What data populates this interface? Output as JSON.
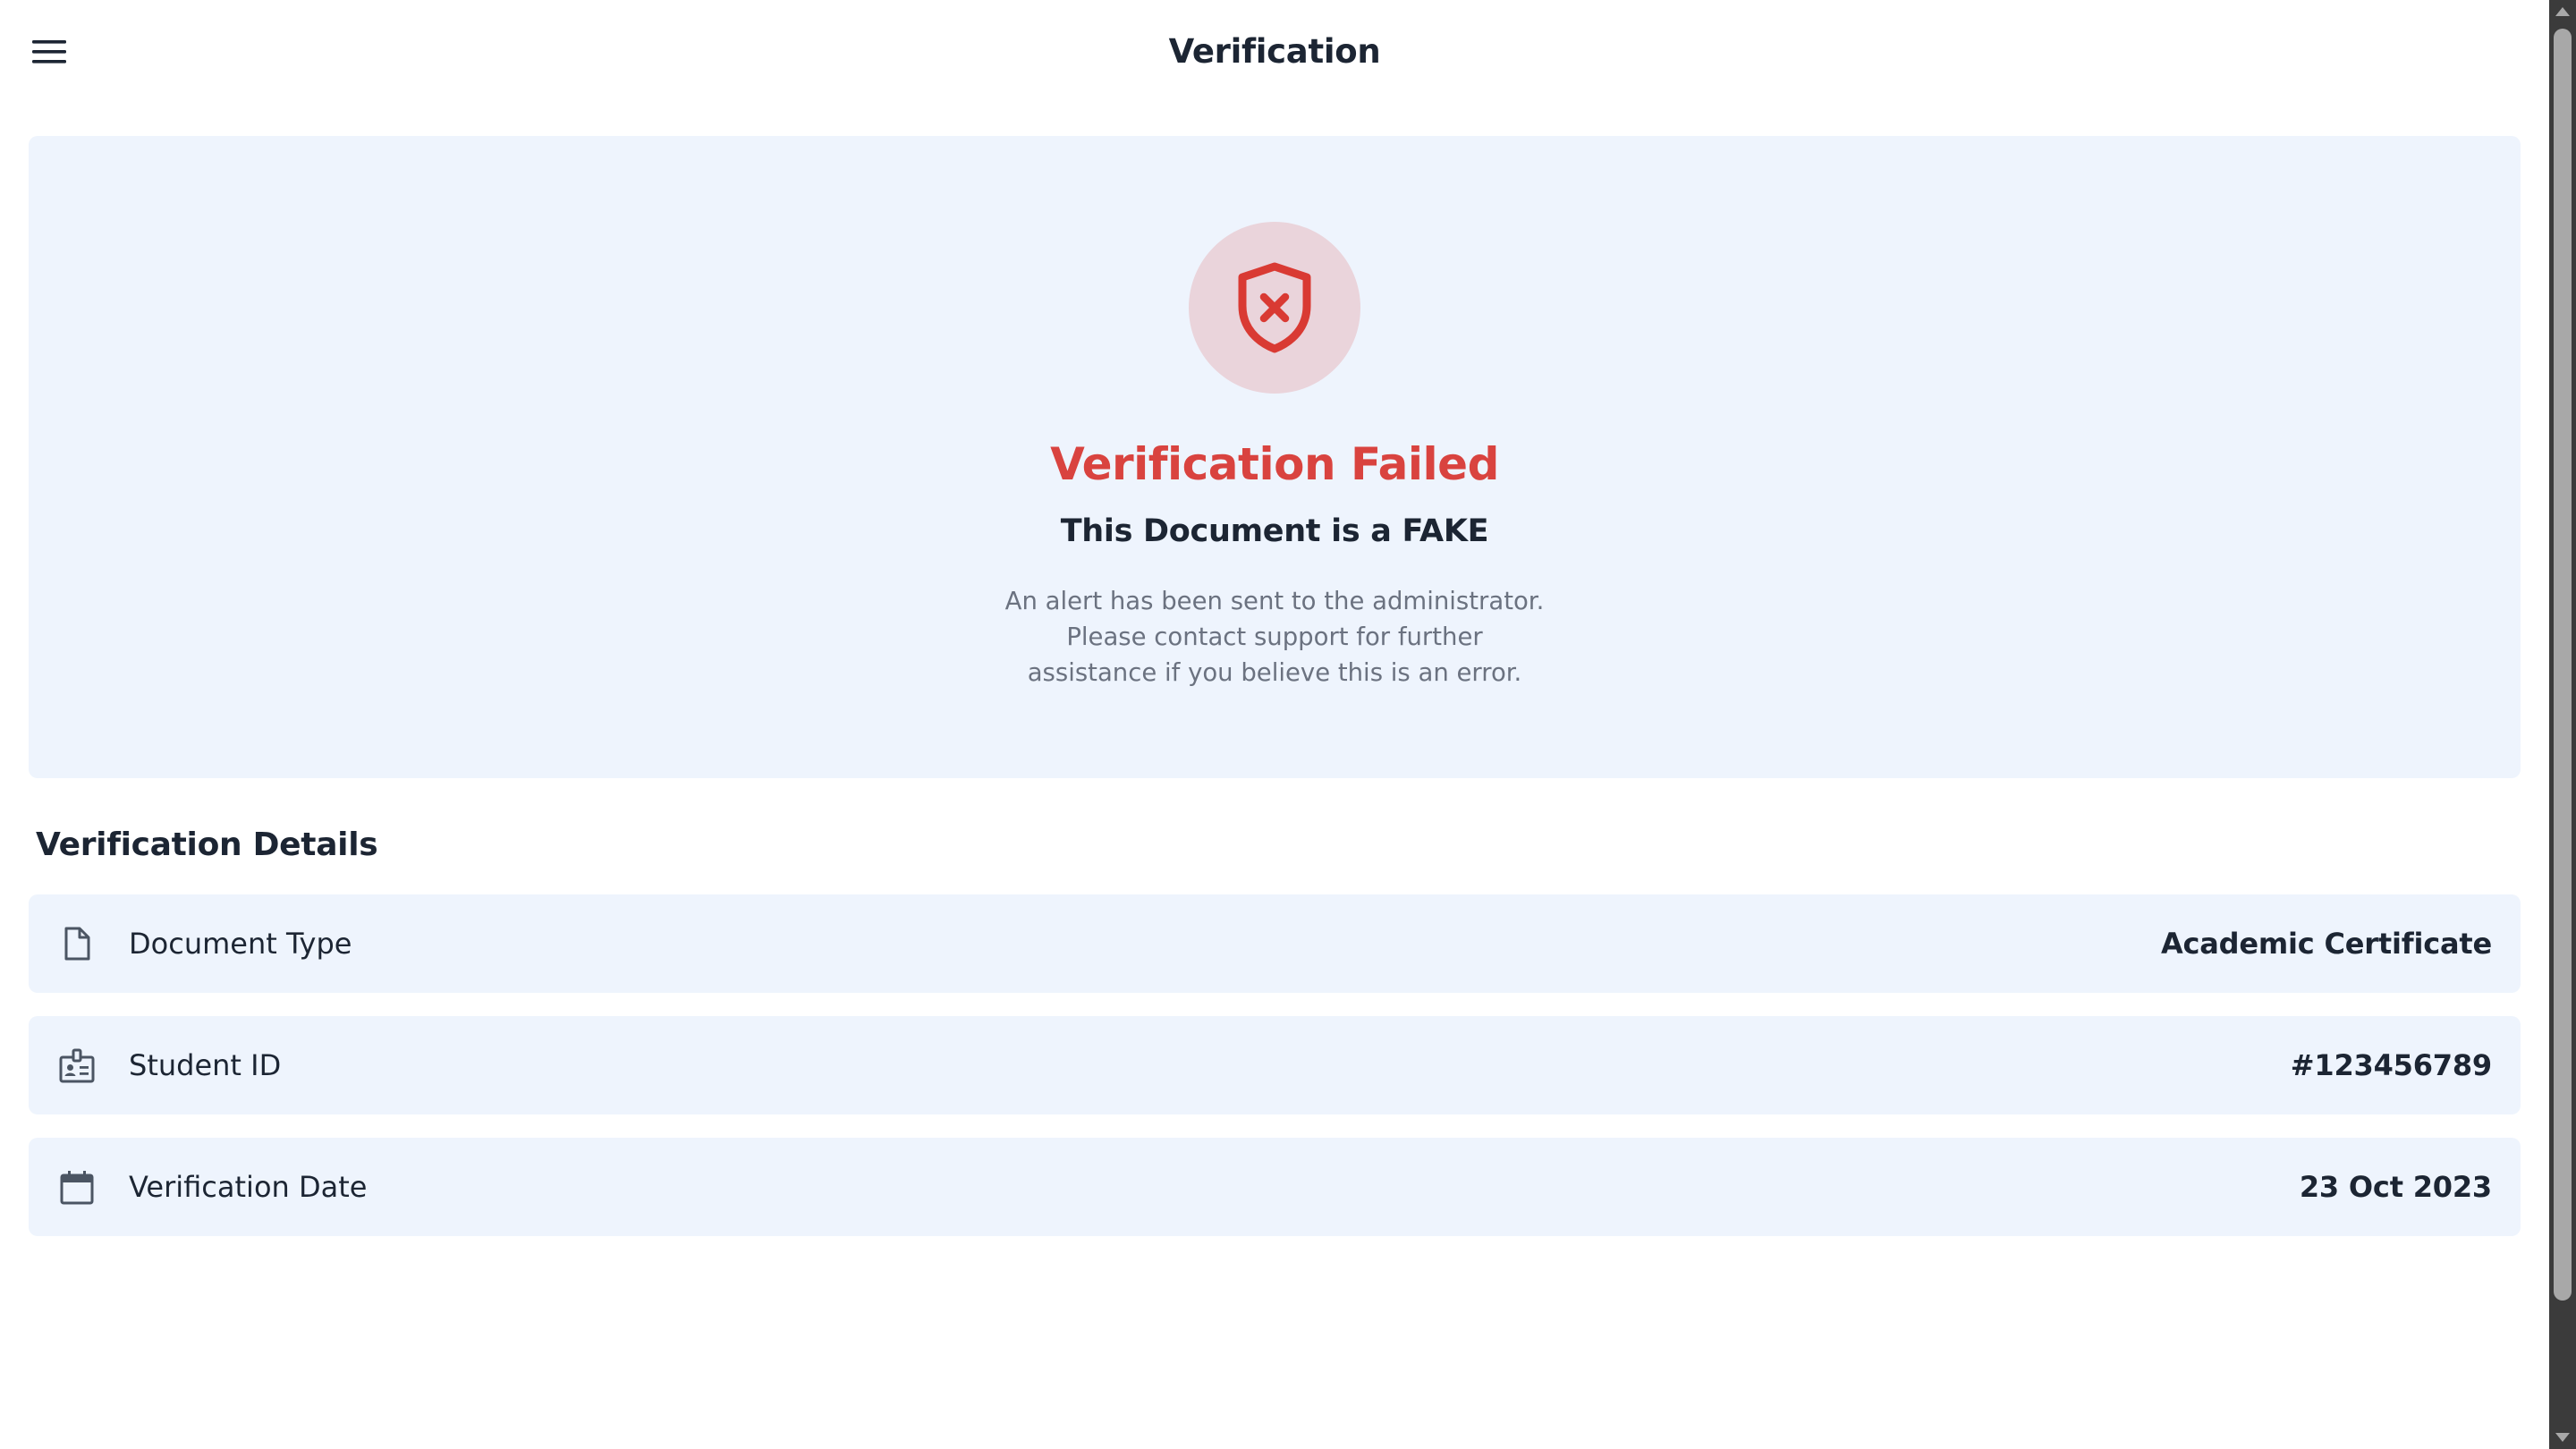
{
  "header": {
    "title": "Verification",
    "menu_icon": "hamburger-menu-icon"
  },
  "status": {
    "icon": "shield-x-icon",
    "title": "Verification Failed",
    "subtitle": "This Document is a FAKE",
    "message": "An alert has been sent to the administrator. Please contact support for further assistance if you believe this is an error.",
    "colors": {
      "error": "#d9433f",
      "icon_circle": "#ead4db",
      "card_background": "#eef4fd"
    }
  },
  "details": {
    "heading": "Verification Details",
    "rows": [
      {
        "icon": "document-icon",
        "label": "Document Type",
        "value": "Academic Certificate"
      },
      {
        "icon": "id-badge-icon",
        "label": "Student ID",
        "value": "#123456789"
      },
      {
        "icon": "calendar-icon",
        "label": "Verification Date",
        "value": "23 Oct 2023"
      }
    ]
  }
}
